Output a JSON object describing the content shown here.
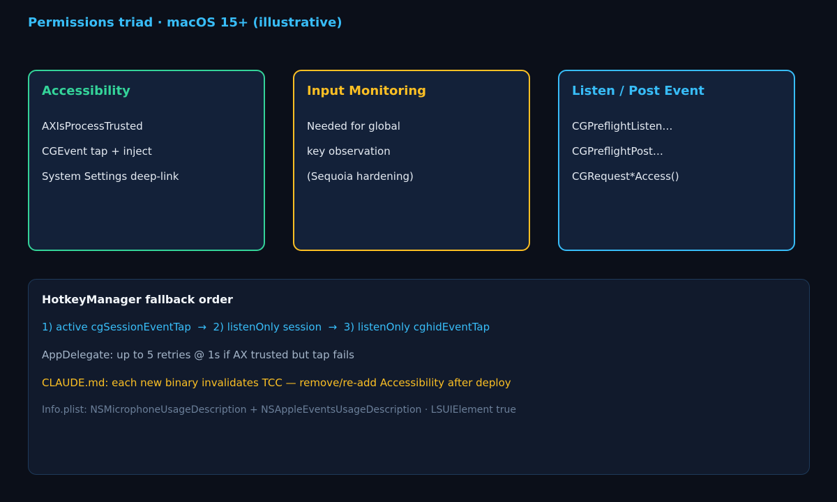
{
  "title": "Permissions triad · macOS 15+ (illustrative)",
  "cards": [
    {
      "title": "Accessibility",
      "accent": "#34d399",
      "lines": [
        "AXIsProcessTrusted",
        "CGEvent tap + inject",
        "System Settings deep-link"
      ]
    },
    {
      "title": "Input Monitoring",
      "accent": "#fbbf24",
      "lines": [
        "Needed for global",
        "key observation",
        "(Sequoia hardening)"
      ]
    },
    {
      "title": "Listen / Post Event",
      "accent": "#38bdf8",
      "lines": [
        "CGPreflightListen…",
        "CGPreflightPost…",
        "CGRequest*Access()"
      ]
    }
  ],
  "panel": {
    "heading": "HotkeyManager fallback order",
    "fallback": "1) active cgSessionEventTap  →  2) listenOnly session  →  3) listenOnly cghidEventTap",
    "retries": "AppDelegate: up to 5 retries @ 1s if AX trusted but tap fails",
    "claude_note": "CLAUDE.md: each new binary invalidates TCC — remove/re-add Accessibility after deploy",
    "plist": "Info.plist: NSMicrophoneUsageDescription + NSAppleEventsUsageDescription · LSUIElement true"
  },
  "colors": {
    "background": "#0b0f19",
    "card_fill": "#132139",
    "panel_fill": "#111a2c",
    "panel_border": "#1e3a5a",
    "heading_text": "#f1f5f9",
    "fallback_text": "#38bdf8",
    "retries_text": "#a3b4c8",
    "claude_text": "#fbbf24",
    "plist_text": "#6b7f99"
  }
}
